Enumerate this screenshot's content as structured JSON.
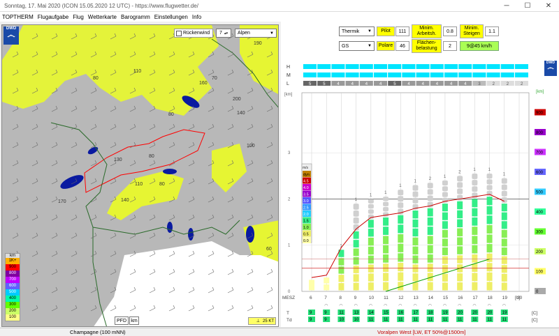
{
  "window": {
    "title": "Sonntag, 17. Mai 2020 (ICON 15.05.2020 12 UTC) - https://www.flugwetter.de/"
  },
  "menu": [
    "TOPTHERM",
    "Flugaufgabe",
    "Flug",
    "Wetterkarte",
    "Barogramm",
    "Einstellungen",
    "Info"
  ],
  "map": {
    "logo": "DWD",
    "tailwind_label": "Rückenwind",
    "tailwind_value": "7",
    "region": "Alpen",
    "legend_unit": "km",
    "legend_levels": [
      "1K+",
      "900",
      "800",
      "700",
      "600",
      "500",
      "400",
      "300",
      "200",
      "100"
    ],
    "legend_colors": [
      "#ffb000",
      "#ff0000",
      "#8000a0",
      "#c000ff",
      "#6060ff",
      "#00ccff",
      "#00ffaa",
      "#60ff00",
      "#ccff66",
      "#ffff88"
    ],
    "pfd_label": "PFD",
    "km_label": "km",
    "wind_label": "25 KT",
    "contour_labels": [
      "190",
      "160",
      "110",
      "70",
      "80",
      "200",
      "140",
      "100",
      "130",
      "110",
      "80",
      "140",
      "60",
      "170",
      "80",
      "80"
    ]
  },
  "controls": {
    "mode": "Thermik",
    "pilot_label": "Pilot",
    "pilot_value": "111",
    "minarb_label": "Minim. Arbeitsh.",
    "minarb_value": "0.8",
    "minsteig_label": "Minim. Steigen",
    "minsteig_value": "1.1",
    "type": "GS",
    "polare_label": "Polare",
    "polare_value": "46",
    "flaechen_label": "Flächen-belastung",
    "flaechen_value": "2",
    "speed_result": "9@45 km/h"
  },
  "chart": {
    "logo": "DWD",
    "layer_labels": [
      "H",
      "M",
      "L"
    ],
    "low_cloud_values": [
      "5",
      "5",
      "4",
      "4",
      "4",
      "4",
      "5",
      "4",
      "4",
      "4",
      "4",
      "4",
      "3",
      "2",
      "2",
      "2"
    ],
    "left_axis_unit": "[km]",
    "left_ticks": [
      "0",
      "1",
      "2",
      "3",
      "4"
    ],
    "right_axis_unit": "[km]",
    "right_ticks": [
      "0",
      "100",
      "200",
      "300",
      "400",
      "500",
      "600",
      "700",
      "800",
      "900"
    ],
    "right_tick_colors": [
      "#aaaaaa",
      "#ffff66",
      "#ccff66",
      "#66ff33",
      "#33ff99",
      "#33ccff",
      "#6666ff",
      "#cc33ff",
      "#9900cc",
      "#cc0000"
    ],
    "ms_scale_unit": "m/s",
    "ms_scale": [
      "dyn",
      "4.5",
      "4.0",
      "3.5",
      "3.0",
      "2.5",
      "2.0",
      "1.5",
      "1.0",
      "0.5",
      "0.0"
    ],
    "ms_colors": [
      "#c08000",
      "#cc0000",
      "#cc00cc",
      "#9900cc",
      "#5555ff",
      "#3399ff",
      "#22ccff",
      "#33ee88",
      "#88ee55",
      "#eeee66",
      "#ffffaa"
    ],
    "x_label": "MESZ",
    "hours": [
      "6",
      "7",
      "8",
      "9",
      "10",
      "11",
      "12",
      "13",
      "14",
      "15",
      "16",
      "17",
      "18",
      "19",
      "20"
    ],
    "hour_unit": "[h]",
    "cloud_counts": [
      "1",
      "1",
      "1",
      "1",
      "1",
      "1",
      "1",
      "1",
      "2",
      "1",
      "2",
      "1",
      "1",
      "1"
    ],
    "temp_label": "T",
    "dew_label": "Td",
    "temps": [
      "9",
      "9",
      "11",
      "13",
      "14",
      "15",
      "16",
      "17",
      "18",
      "19",
      "20",
      "20",
      "20",
      "19"
    ],
    "dews": [
      "9",
      "9",
      "10",
      "10",
      "11",
      "11",
      "11",
      "11",
      "11",
      "11",
      "11",
      "11",
      "11",
      "11"
    ],
    "temp_unit": "[C]",
    "bars": [
      0.25,
      0.3,
      0.9,
      1.3,
      1.55,
      1.6,
      1.65,
      1.75,
      1.8,
      1.9,
      1.95,
      2.0,
      2.05,
      1.9
    ],
    "cloud_top": [
      0,
      0,
      0,
      1.9,
      2.0,
      2.05,
      2.2,
      2.3,
      2.35,
      2.4,
      2.5,
      2.55,
      2.55,
      2.45
    ]
  },
  "status": {
    "left": "Champagne (100 mNN)",
    "right": "Voralpen West [LW, ET  50%@1500m]"
  }
}
